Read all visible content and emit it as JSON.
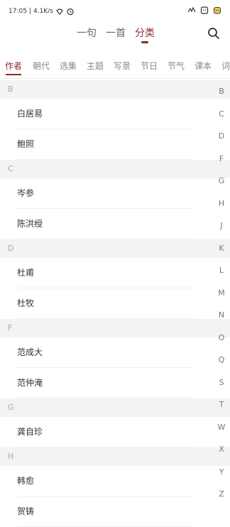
{
  "status": {
    "time": "17:05",
    "net": "4.1K/s",
    "right_icons": [
      "vibrate-icon",
      "battery-face-icon",
      "cat-battery-icon"
    ]
  },
  "top_tabs": [
    {
      "label": "一句",
      "active": false
    },
    {
      "label": "一首",
      "active": false
    },
    {
      "label": "分类",
      "active": true
    }
  ],
  "categories": [
    "作者",
    "朝代",
    "选集",
    "主题",
    "写景",
    "节日",
    "节气",
    "课本",
    "词"
  ],
  "sections": [
    {
      "letter": "B",
      "items": [
        "白居易",
        "鲍照"
      ]
    },
    {
      "letter": "C",
      "items": [
        "岑参",
        "陈洪绶"
      ]
    },
    {
      "letter": "D",
      "items": [
        "杜甫",
        "杜牧"
      ]
    },
    {
      "letter": "F",
      "items": [
        "范成大",
        "范仲淹"
      ]
    },
    {
      "letter": "G",
      "items": [
        "龚自珍"
      ]
    },
    {
      "letter": "H",
      "items": [
        "韩愈",
        "贺铸"
      ]
    }
  ],
  "index": [
    "B",
    "C",
    "D",
    "F",
    "G",
    "H",
    "J",
    "K",
    "L",
    "M",
    "N",
    "O",
    "Q",
    "S",
    "T",
    "W",
    "X",
    "Y",
    "Z"
  ],
  "colors": {
    "accent": "#8c2d2d",
    "section_bg": "#f3f2f4"
  }
}
